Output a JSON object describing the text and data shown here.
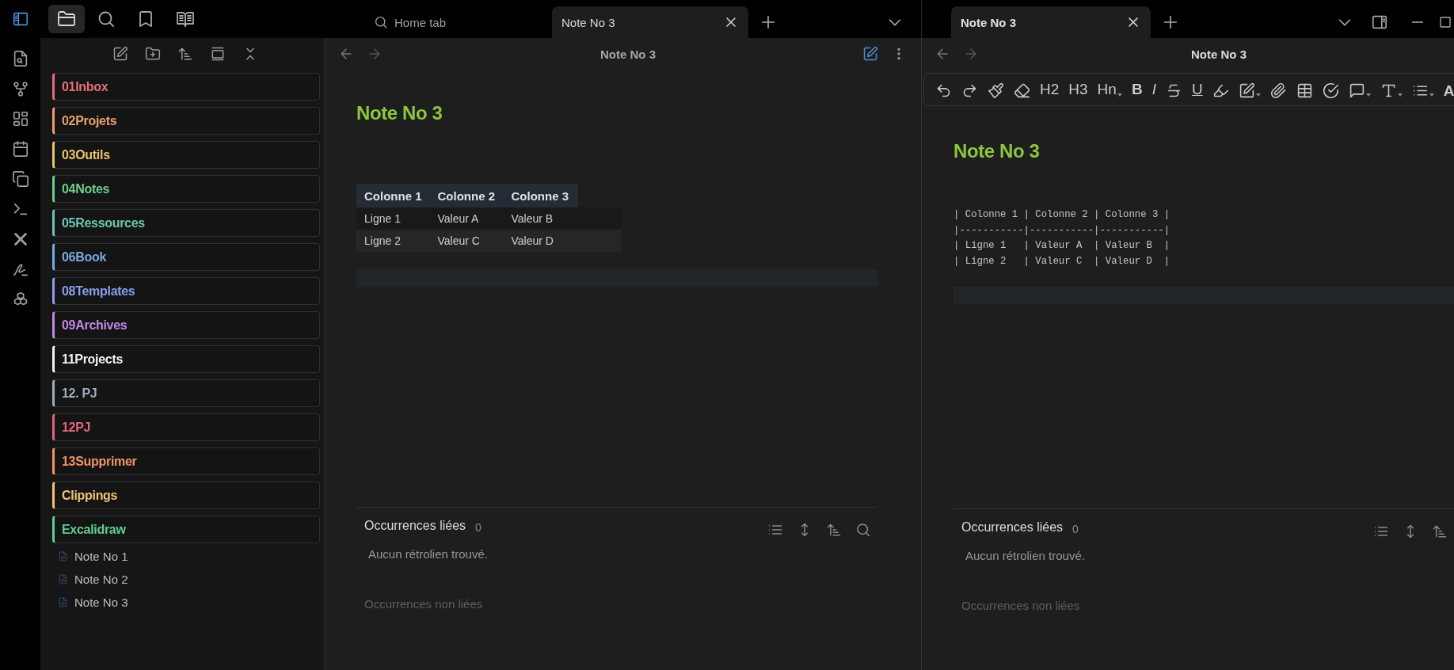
{
  "sidebar_tabs": [
    {
      "selected": true
    },
    {
      "selected": false
    },
    {
      "selected": false
    },
    {
      "selected": false
    }
  ],
  "file_tree": {
    "folders": [
      {
        "name": "01Inbox",
        "color": "#e3707a"
      },
      {
        "name": "02Projets",
        "color": "#e89f6c"
      },
      {
        "name": "03Outils",
        "color": "#e8c46e"
      },
      {
        "name": "04Notes",
        "color": "#6dce8c"
      },
      {
        "name": "05Ressources",
        "color": "#6cc6b4"
      },
      {
        "name": "06Book",
        "color": "#79a8e0"
      },
      {
        "name": "08Templates",
        "color": "#8b9ef0"
      },
      {
        "name": "09Archives",
        "color": "#c088e6"
      },
      {
        "name": "11Projects",
        "color": "#f2f2f2"
      },
      {
        "name": "12. PJ",
        "color": "#a3abc2"
      },
      {
        "name": "12PJ",
        "color": "#e3667f"
      },
      {
        "name": "13Supprimer",
        "color": "#f0956a"
      },
      {
        "name": "Clippings",
        "color": "#efc274"
      },
      {
        "name": "Excalidraw",
        "color": "#5fcf8b"
      }
    ],
    "notes": [
      {
        "name": "Note No 1"
      },
      {
        "name": "Note No 2"
      },
      {
        "name": "Note No 3"
      }
    ]
  },
  "left_pane": {
    "focused": false,
    "tabs": [
      {
        "label": "Home tab",
        "kind": "home",
        "selected": false
      },
      {
        "label": "Note No 3",
        "kind": "note",
        "selected": true
      }
    ],
    "header_title": "Note No 3",
    "note": {
      "title": "Note No 3",
      "table": {
        "columns": [
          "Colonne 1",
          "Colonne 2",
          "Colonne 3"
        ],
        "rows": [
          [
            "Ligne 1",
            "Valeur A",
            "Valeur B"
          ],
          [
            "Ligne 2",
            "Valeur C",
            "Valeur D"
          ]
        ]
      }
    },
    "backlinks": {
      "linked_title": "Occurrences liées",
      "count": "0",
      "empty_text": "Aucun rétrolien trouvé.",
      "unlinked_title": "Occurrences non liées"
    }
  },
  "right_pane": {
    "focused": true,
    "tabs": [
      {
        "label": "Note No 3",
        "kind": "note",
        "selected": true
      }
    ],
    "header_title": "Note No 3",
    "toolbar": [
      {
        "label": "H2",
        "kind": "heading",
        "dropdown": false
      },
      {
        "label": "H3",
        "kind": "heading",
        "dropdown": false
      },
      {
        "label": "Hn",
        "kind": "heading",
        "dropdown": true
      },
      {
        "label": "B",
        "kind": "bold",
        "dropdown": false
      },
      {
        "label": "I",
        "kind": "italic",
        "dropdown": false
      },
      {
        "label": "U",
        "kind": "underline",
        "dropdown": false
      },
      {
        "label": "A",
        "kind": "text-color",
        "dropdown": false
      }
    ],
    "note": {
      "title": "Note No 3",
      "source_lines": [
        "| Colonne 1 | Colonne 2 | Colonne 3 |",
        "|-----------|-----------|-----------|",
        "| Ligne 1   | Valeur A  | Valeur B  |",
        "| Ligne 2   | Valeur C  | Valeur D  |"
      ]
    },
    "backlinks": {
      "linked_title": "Occurrences liées",
      "count": "0",
      "empty_text": "Aucun rétrolien trouvé.",
      "unlinked_title": "Occurrences non liées"
    }
  }
}
